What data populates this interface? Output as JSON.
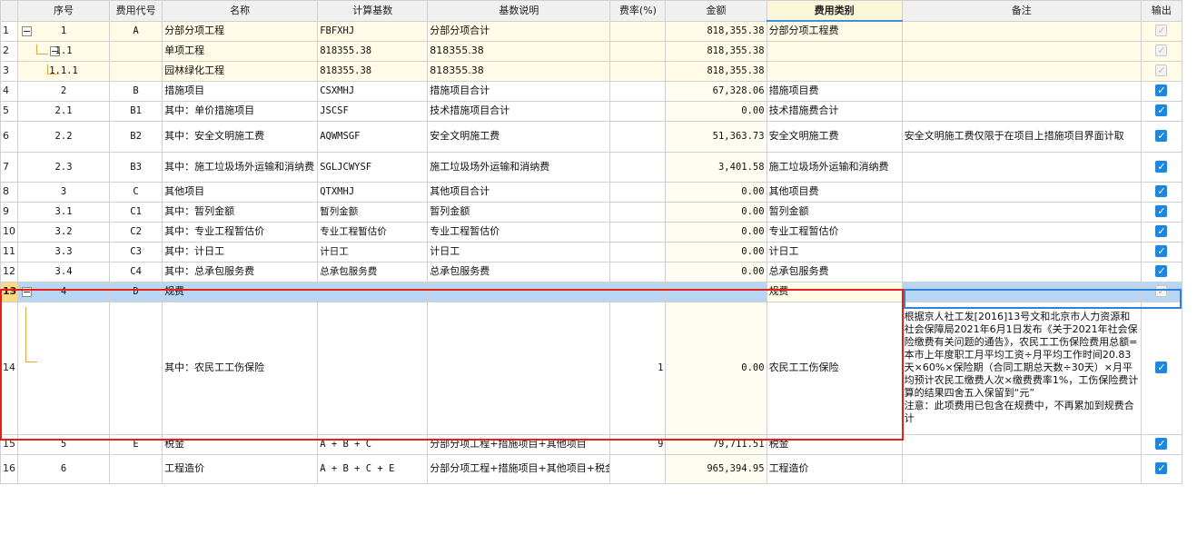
{
  "columns": {
    "seq": "序号",
    "code": "费用代号",
    "name": "名称",
    "base": "计算基数",
    "base_desc": "基数说明",
    "rate": "费率(%)",
    "amount": "金额",
    "category": "费用类别",
    "note": "备注",
    "output": "输出"
  },
  "rows": [
    {
      "rn": "1",
      "seq": "1",
      "code": "A",
      "name": "分部分项工程",
      "base": "FBFXHJ",
      "base_desc": "分部分项合计",
      "rate": "",
      "amount": "818,355.38",
      "category": "分部分项工程费",
      "note": "",
      "output": "disabled"
    },
    {
      "rn": "2",
      "seq": "1.1",
      "code": "",
      "name": "单项工程",
      "base": "818355.38",
      "base_desc": "818355.38",
      "rate": "",
      "amount": "818,355.38",
      "category": "",
      "note": "",
      "output": "disabled"
    },
    {
      "rn": "3",
      "seq": "1.1.1",
      "code": "",
      "name": "园林绿化工程",
      "base": "818355.38",
      "base_desc": "818355.38",
      "rate": "",
      "amount": "818,355.38",
      "category": "",
      "note": "",
      "output": "disabled"
    },
    {
      "rn": "4",
      "seq": "2",
      "code": "B",
      "name": "措施项目",
      "base": "CSXMHJ",
      "base_desc": "措施项目合计",
      "rate": "",
      "amount": "67,328.06",
      "category": "措施项目费",
      "note": "",
      "output": "checked"
    },
    {
      "rn": "5",
      "seq": "2.1",
      "code": "B1",
      "name": "其中：单价措施项目",
      "base": "JSCSF",
      "base_desc": "技术措施项目合计",
      "rate": "",
      "amount": "0.00",
      "category": "技术措施费合计",
      "note": "",
      "output": "checked"
    },
    {
      "rn": "6",
      "seq": "2.2",
      "code": "B2",
      "name": "其中：安全文明施工费",
      "base": "AQWMSGF",
      "base_desc": "安全文明施工费",
      "rate": "",
      "amount": "51,363.73",
      "category": "安全文明施工费",
      "note": "安全文明施工费仅限于在项目上措施项目界面计取",
      "output": "checked"
    },
    {
      "rn": "7",
      "seq": "2.3",
      "code": "B3",
      "name": "其中：施工垃圾场外运输和消纳费",
      "base": "SGLJCWYSF",
      "base_desc": "施工垃圾场外运输和消纳费",
      "rate": "",
      "amount": "3,401.58",
      "category": "施工垃圾场外运输和消纳费",
      "note": "",
      "output": "checked"
    },
    {
      "rn": "8",
      "seq": "3",
      "code": "C",
      "name": "其他项目",
      "base": "QTXMHJ",
      "base_desc": "其他项目合计",
      "rate": "",
      "amount": "0.00",
      "category": "其他项目费",
      "note": "",
      "output": "checked"
    },
    {
      "rn": "9",
      "seq": "3.1",
      "code": "C1",
      "name": "其中：暂列金额",
      "base": "暂列金额",
      "base_desc": "暂列金额",
      "rate": "",
      "amount": "0.00",
      "category": "暂列金额",
      "note": "",
      "output": "checked"
    },
    {
      "rn": "10",
      "seq": "3.2",
      "code": "C2",
      "name": "其中：专业工程暂估价",
      "base": "专业工程暂估价",
      "base_desc": "专业工程暂估价",
      "rate": "",
      "amount": "0.00",
      "category": "专业工程暂估价",
      "note": "",
      "output": "checked"
    },
    {
      "rn": "11",
      "seq": "3.3",
      "code": "C3",
      "name": "其中：计日工",
      "base": "计日工",
      "base_desc": "计日工",
      "rate": "",
      "amount": "0.00",
      "category": "计日工",
      "note": "",
      "output": "checked"
    },
    {
      "rn": "12",
      "seq": "3.4",
      "code": "C4",
      "name": "其中：总承包服务费",
      "base": "总承包服务费",
      "base_desc": "总承包服务费",
      "rate": "",
      "amount": "0.00",
      "category": "总承包服务费",
      "note": "",
      "output": "checked"
    },
    {
      "rn": "13",
      "seq": "4",
      "code": "D",
      "name": "规费",
      "base": "",
      "base_desc": "",
      "rate": "",
      "amount": "",
      "category": "规费",
      "note": "",
      "output": "disabled"
    },
    {
      "rn": "14",
      "seq": "",
      "code": "",
      "name": "其中：农民工工伤保险",
      "base": "",
      "base_desc": "",
      "rate": "1",
      "amount": "0.00",
      "category": "农民工工伤保险",
      "note": "根据京人社工发[2016]13号文和北京市人力资源和社会保障局2021年6月1日发布《关于2021年社会保险缴费有关问题的通告》，农民工工伤保险费用总额=本市上年度职工月平均工资÷月平均工作时间20.83天×60%×保险期（合同工期总天数÷30天）×月平均预计农民工缴费人次×缴费费率1%，工伤保险费计算的结果四舍五入保留到“元”\n注意：此项费用已包含在规费中，不再累加到规费合计",
      "output": "checked"
    },
    {
      "rn": "15",
      "seq": "5",
      "code": "E",
      "name": "税金",
      "base": "A + B + C",
      "base_desc": "分部分项工程+措施项目+其他项目",
      "rate": "9",
      "amount": "79,711.51",
      "category": "税金",
      "note": "",
      "output": "checked"
    },
    {
      "rn": "16",
      "seq": "6",
      "code": "",
      "name": "工程造价",
      "base": "A + B + C + E",
      "base_desc": "分部分项工程+措施项目+其他项目+税金",
      "rate": "",
      "amount": "965,394.95",
      "category": "工程造价",
      "note": "",
      "output": "checked"
    }
  ],
  "colors": {
    "selected_row": "#b8d6f2",
    "highlight_box": "#e4201b",
    "checkbox": "#1e86e0",
    "yellow_row": "#fffbe6"
  },
  "icons": {
    "collapse": "collapse-icon",
    "checkbox": "checkbox-checked-icon"
  }
}
